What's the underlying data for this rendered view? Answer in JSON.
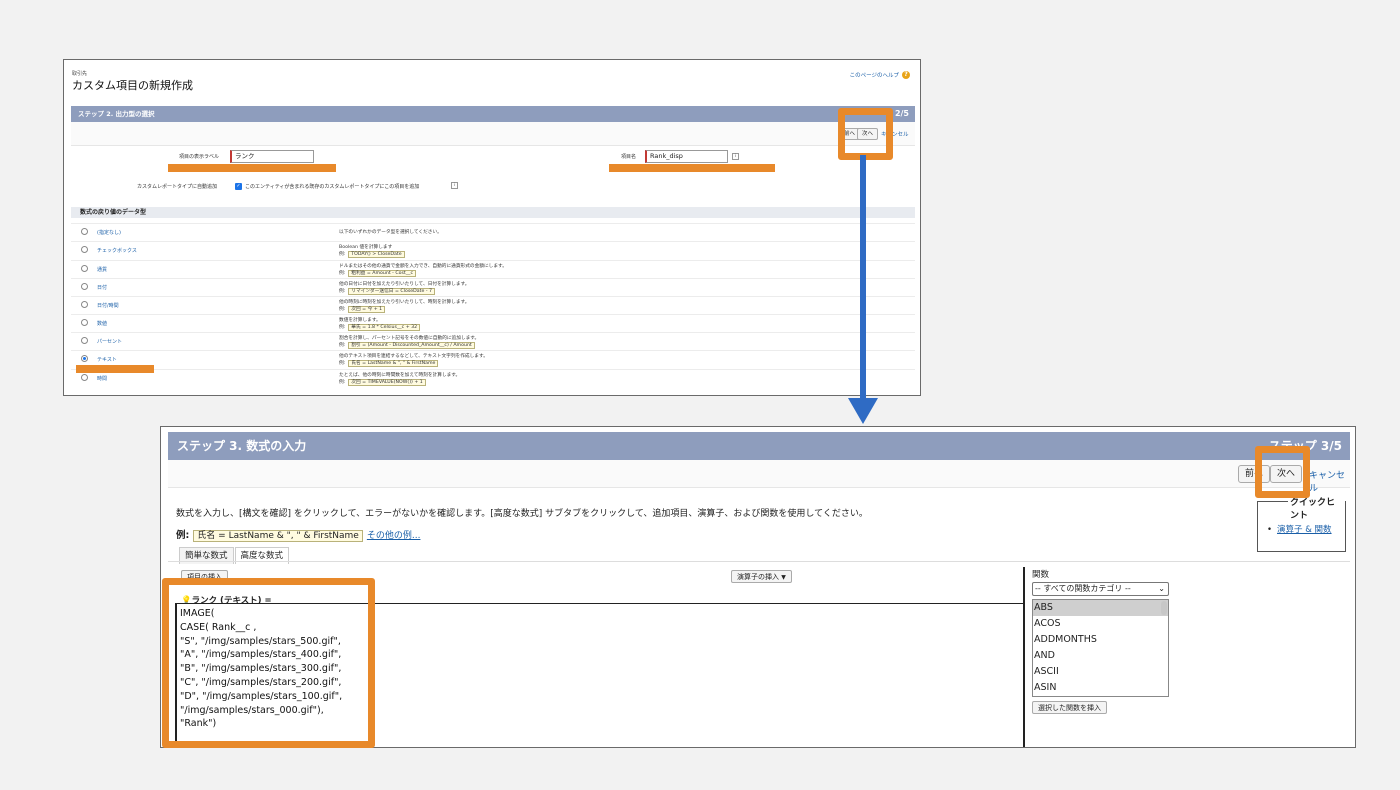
{
  "step2": {
    "breadcrumb": "取引先",
    "title": "カスタム項目の新規作成",
    "help_link": "このページのヘルプ",
    "help_icon": "?",
    "step_title": "ステップ 2. 出力型の選択",
    "step_num": "2/5",
    "buttons": {
      "prev": "前へ",
      "next": "次へ",
      "cancel": "キャンセル"
    },
    "field_label_label": "項目の表示ラベル",
    "field_label_value": "ランク",
    "field_name_label": "項目名",
    "field_name_value": "Rank_disp",
    "info_icon": "i",
    "report_label": "カスタムレポートタイプに自動追加",
    "report_text": "このエンティティが含まれる既存のカスタムレポートタイプにこの項目を追加",
    "section_title": "数式の戻り値のデータ型",
    "options": [
      {
        "label": "(指定なし)",
        "desc": "以下のいずれかのデータ型を選択してください。",
        "example": "",
        "selected": false
      },
      {
        "label": "チェックボックス",
        "desc": "Boolean 値を計算します",
        "example": "TODAY() > CloseDate",
        "selected": false
      },
      {
        "label": "通貨",
        "desc": "ドルまたはその他の通貨で金額を入力でき、自動的に通貨形式の金額にします。",
        "example": "粗利益 = Amount - Cost__c",
        "selected": false
      },
      {
        "label": "日付",
        "desc": "他の日付に日付を加えたり引いたりして、日付を計算します。",
        "example": "リマインダー送信日 = CloseDate - 7",
        "selected": false
      },
      {
        "label": "日付/時間",
        "desc": "他の時刻に時刻を加えたり引いたりして、時刻を計算します。",
        "example": "次回 = 今 + 1",
        "selected": false
      },
      {
        "label": "数値",
        "desc": "数値を計算します。",
        "example": "華氏 = 1.8 * Celsius__c + 32",
        "selected": false
      },
      {
        "label": "パーセント",
        "desc": "割合を計算し、パーセント記号をその数値に自動的に追加します。",
        "example": "割引 = (Amount - Discounted_Amount__c) / Amount",
        "selected": false
      },
      {
        "label": "テキスト",
        "desc": "他のテキスト項目を連結するなどして、テキスト文字列を作成します。",
        "example": "氏名 = LastName & \", \" & FirstName",
        "selected": true
      },
      {
        "label": "時間",
        "desc": "たとえば、他の時刻に時間数を加えて時刻を計算します。",
        "example": "次回 = TIMEVALUE(NOW()) + 1",
        "selected": false
      }
    ],
    "example_prefix": "例:"
  },
  "step3": {
    "step_title": "ステップ 3. 数式の入力",
    "step_num": "ステップ 3/5",
    "buttons": {
      "prev": "前へ",
      "next": "次へ",
      "cancel": "キャンセル"
    },
    "instructions": "数式を入力し、[構文を確認] をクリックして、エラーがないかを確認します。[高度な数式] サブタブをクリックして、追加項目、演算子、および関数を使用してください。",
    "example_label": "例:",
    "example_formula": "氏名 = LastName & \", \" & FirstName",
    "more_examples": "その他の例...",
    "tabs": [
      "簡単な数式",
      "高度な数式"
    ],
    "insert_field": "項目の挿入",
    "insert_operator": "演算子の挿入",
    "operator_chevron": "▼",
    "formula_label": "ランク (テキスト) =",
    "formula": "IMAGE(\nCASE( Rank__c ,\n\"S\", \"/img/samples/stars_500.gif\",\n\"A\", \"/img/samples/stars_400.gif\",\n\"B\", \"/img/samples/stars_300.gif\",\n\"C\", \"/img/samples/stars_200.gif\",\n\"D\", \"/img/samples/stars_100.gif\",\n\"/img/samples/stars_000.gif\"),\n\"Rank\")",
    "functions_label": "関数",
    "function_category": "-- すべての関数カテゴリ --",
    "functions": [
      "ABS",
      "ACOS",
      "ADDMONTHS",
      "AND",
      "ASCII",
      "ASIN"
    ],
    "insert_function": "選択した関数を挿入",
    "quick_hint_title": "クイックヒント",
    "quick_hint_link": "演算子 & 関数"
  },
  "colors": {
    "highlight": "#e8892a",
    "arrow": "#2f6bc4",
    "step_bar": "#8e9dbd",
    "link": "#1a5fa8"
  }
}
